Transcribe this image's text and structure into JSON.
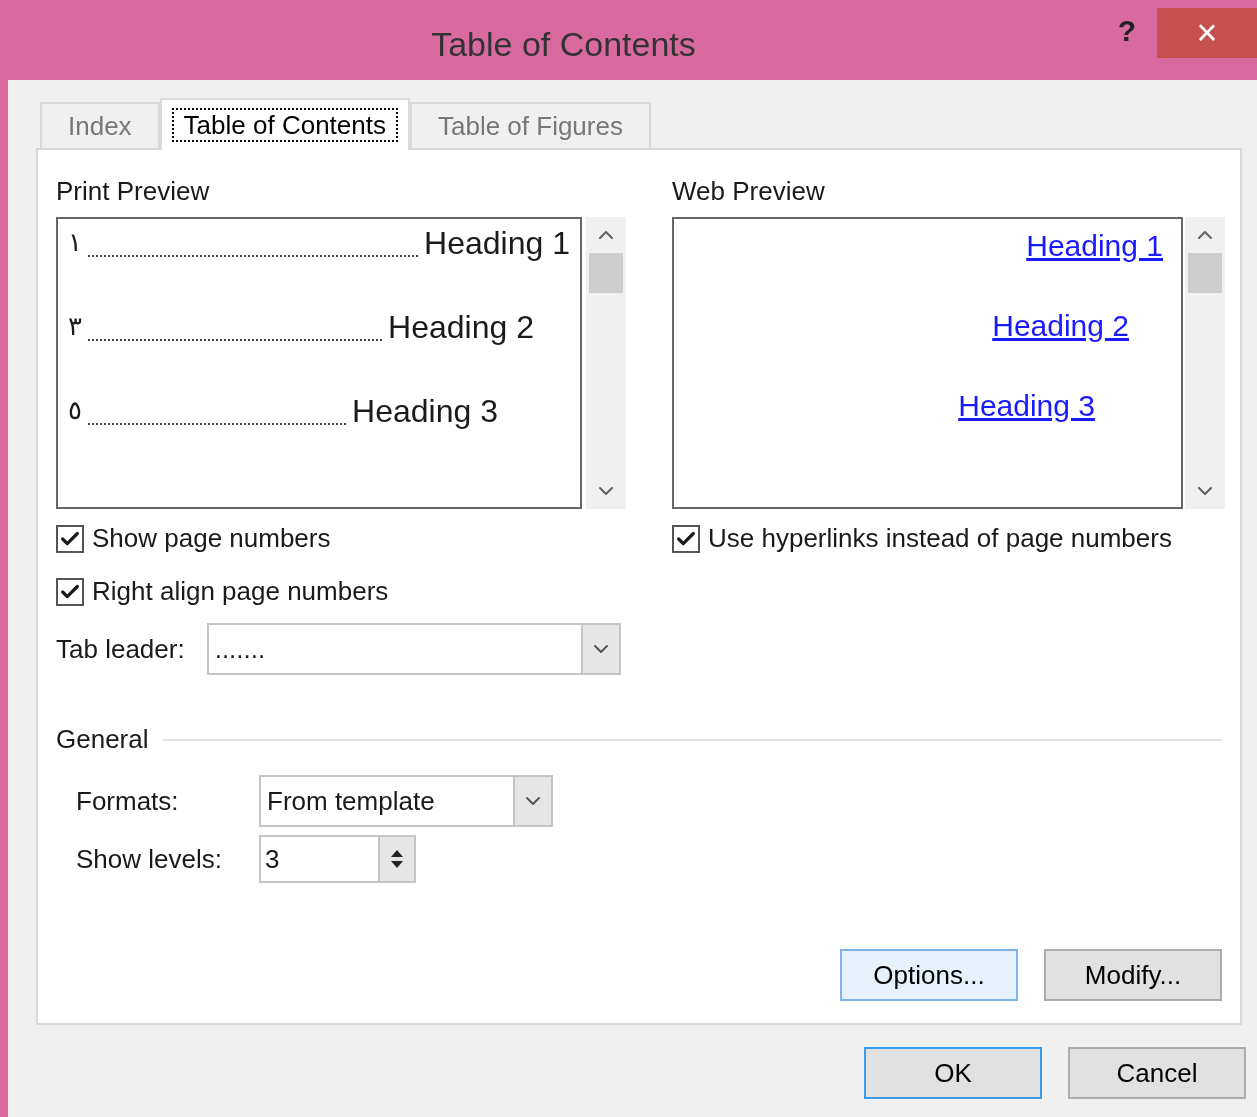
{
  "window": {
    "title": "Table of Contents",
    "help": "?",
    "close": "×"
  },
  "tabs": [
    {
      "label": "Index",
      "selected": false
    },
    {
      "label": "Table of Contents",
      "selected": true
    },
    {
      "label": "Table of Figures",
      "selected": false
    }
  ],
  "print_preview": {
    "label": "Print Preview",
    "entries": [
      {
        "page": "١",
        "heading": "Heading 1"
      },
      {
        "page": "٣",
        "heading": "Heading 2"
      },
      {
        "page": "٥",
        "heading": "Heading 3"
      }
    ]
  },
  "show_page_numbers": {
    "label": "Show page numbers",
    "checked": true
  },
  "right_align_page_numbers": {
    "label": "Right align page numbers",
    "checked": true
  },
  "tab_leader": {
    "label": "Tab leader:",
    "value": "......."
  },
  "web_preview": {
    "label": "Web Preview",
    "links": [
      "Heading 1",
      "Heading 2",
      "Heading 3"
    ]
  },
  "use_hyperlinks": {
    "label": "Use hyperlinks instead of page numbers",
    "checked": true
  },
  "general": {
    "label": "General",
    "formats": {
      "label": "Formats:",
      "value": "From template"
    },
    "show_levels": {
      "label": "Show levels:",
      "value": "3"
    }
  },
  "panel_buttons": [
    {
      "label": "Options...",
      "kind": "hover"
    },
    {
      "label": "Modify...",
      "kind": "normal"
    }
  ],
  "dialog_buttons": [
    {
      "label": "OK",
      "kind": "default"
    },
    {
      "label": "Cancel",
      "kind": "normal"
    }
  ]
}
